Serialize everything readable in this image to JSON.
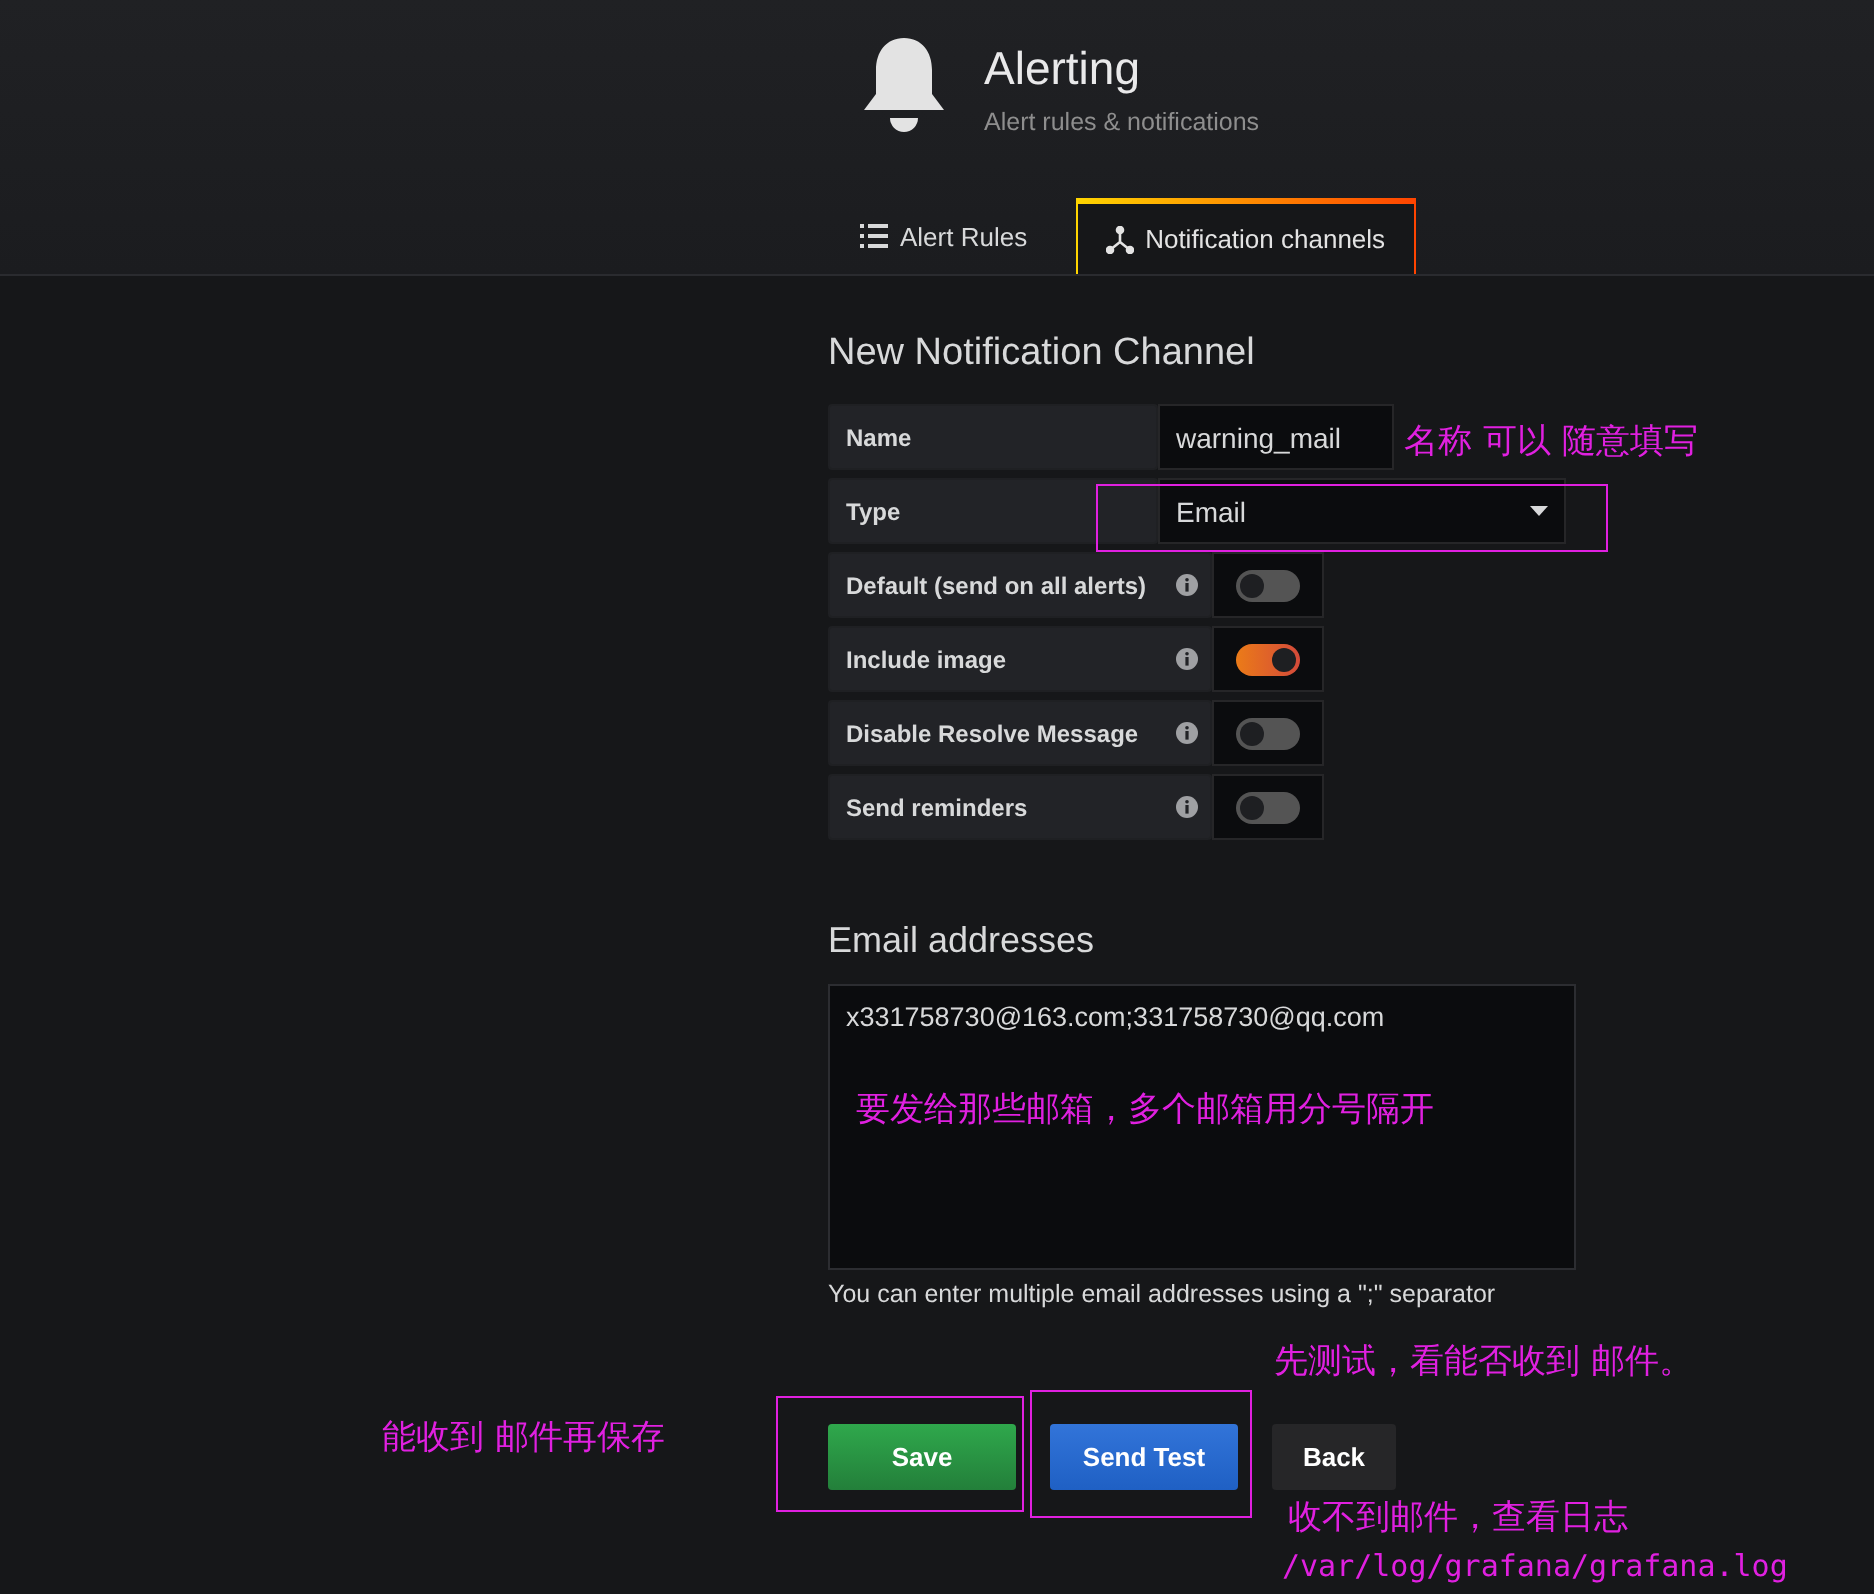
{
  "header": {
    "title": "Alerting",
    "subtitle": "Alert rules & notifications"
  },
  "tabs": [
    {
      "label": "Alert Rules",
      "selected": false
    },
    {
      "label": "Notification channels",
      "selected": true
    }
  ],
  "form": {
    "title": "New Notification Channel",
    "fields": [
      {
        "kind": "input",
        "label": "Name",
        "value": "warning_mail"
      },
      {
        "kind": "select",
        "label": "Type",
        "value": "Email"
      }
    ],
    "switches": [
      {
        "label": "Default (send on all alerts)",
        "on": false
      },
      {
        "label": "Include image",
        "on": true
      },
      {
        "label": "Disable Resolve Message",
        "on": false
      },
      {
        "label": "Send reminders",
        "on": false
      }
    ]
  },
  "email": {
    "title": "Email addresses",
    "value": "x331758730@163.com;331758730@qq.com",
    "help": "You can enter multiple email addresses using a \";\" separator"
  },
  "buttons": [
    {
      "kind": "primary",
      "label": "Save"
    },
    {
      "kind": "test",
      "label": "Send Test"
    },
    {
      "kind": "secondary",
      "label": "Back"
    }
  ],
  "annotations": [
    {
      "kind": "text",
      "text": "名称  可以  随意填写"
    },
    {
      "kind": "frame"
    },
    {
      "kind": "text",
      "text": "要发给那些邮箱，多个邮箱用分号隔开"
    },
    {
      "kind": "text",
      "text": "先测试，看能否收到 邮件。"
    },
    {
      "kind": "text",
      "text": "能收到 邮件再保存"
    },
    {
      "kind": "frame"
    },
    {
      "kind": "frame"
    },
    {
      "kind": "text",
      "text": "收不到邮件，查看日志"
    },
    {
      "kind": "mono",
      "text": "/var/log/grafana/grafana.log"
    }
  ]
}
